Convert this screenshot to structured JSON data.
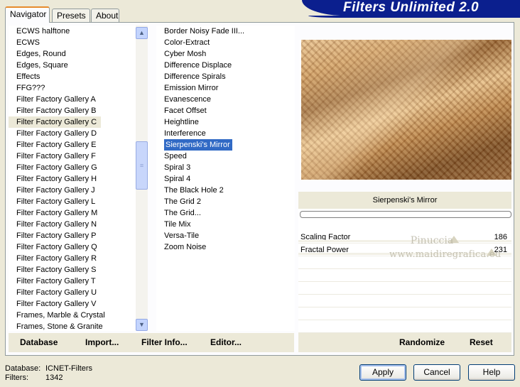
{
  "tabs": [
    {
      "label": "Navigator"
    },
    {
      "label": "Presets"
    },
    {
      "label": "About"
    }
  ],
  "app_title": "Filters Unlimited 2.0",
  "categories": [
    "ECWS halftone",
    "ECWS",
    "Edges, Round",
    "Edges, Square",
    "Effects",
    "FFG???",
    "Filter Factory Gallery A",
    "Filter Factory Gallery B",
    "Filter Factory Gallery C",
    "Filter Factory Gallery D",
    "Filter Factory Gallery E",
    "Filter Factory Gallery F",
    "Filter Factory Gallery G",
    "Filter Factory Gallery H",
    "Filter Factory Gallery J",
    "Filter Factory Gallery L",
    "Filter Factory Gallery M",
    "Filter Factory Gallery N",
    "Filter Factory Gallery P",
    "Filter Factory Gallery Q",
    "Filter Factory Gallery R",
    "Filter Factory Gallery S",
    "Filter Factory Gallery T",
    "Filter Factory Gallery U",
    "Filter Factory Gallery V",
    "Frames, Marble & Crystal",
    "Frames, Stone & Granite"
  ],
  "filters": [
    "Border Noisy Fade III...",
    "Color-Extract",
    "Cyber Mosh",
    "Difference Displace",
    "Difference Spirals",
    "Emission Mirror",
    "Evanescence",
    "Facet Offset",
    "Heightline",
    "Interference",
    "Sierpenski's Mirror",
    "Speed",
    "Spiral 3",
    "Spiral 4",
    "The Black Hole 2",
    "The Grid 2",
    "The Grid...",
    "Tile Mix",
    "Versa-Tile",
    "Zoom Noise"
  ],
  "bottom_buttons": {
    "database": "Database",
    "import": "Import...",
    "filter_info": "Filter Info...",
    "editor": "Editor...",
    "randomize": "Randomize",
    "reset": "Reset"
  },
  "selected_filter_name": "Sierpenski's Mirror",
  "params": [
    {
      "name": "Scaling Factor",
      "value": "186",
      "level": 0.73
    },
    {
      "name": "Fractal Power",
      "value": "231",
      "level": 0.906
    }
  ],
  "watermark": {
    "line1": "Pinuccia",
    "line2": "www.maidiregrafica.eu"
  },
  "status": {
    "database_label": "Database:",
    "database_value": "ICNET-Filters",
    "filters_label": "Filters:",
    "filters_value": "1342"
  },
  "dialog_buttons": {
    "apply": "Apply",
    "cancel": "Cancel",
    "help": "Help"
  }
}
